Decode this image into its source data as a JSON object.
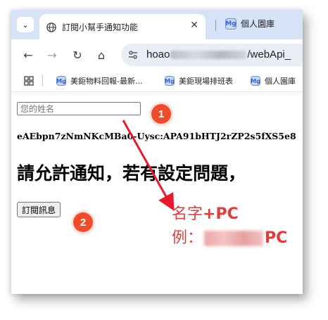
{
  "browser": {
    "tab_active_title": "訂閱小幫手通知功能",
    "tab_close": "✕",
    "tab_list": "⌄",
    "tab2_title": "個人園庫",
    "favicon_badge": "Mg",
    "url_prefix": "hoao",
    "url_suffix": "/webApi_",
    "nav": {
      "back": "←",
      "forward": "→",
      "reload": "↻",
      "home": "⌂"
    },
    "bookmarks": [
      {
        "label": "美鉅物料回報-最新..."
      },
      {
        "label": "美鉅現場排班表"
      },
      {
        "label": "個人園庫"
      }
    ]
  },
  "page": {
    "name_placeholder": "您的姓名",
    "token": "eAEbpn7zNmNKcMBa0-Uysc:APA91bHTJ2rZP2s5fXS5e8",
    "heading": "請允許通知，若有設定問題，",
    "subscribe_label": "訂閱訊息"
  },
  "annotations": {
    "badge1": "1",
    "badge2": "2",
    "line1_prefix": "名字",
    "line1_suffix": "+PC",
    "line2_prefix": "例：",
    "line2_suffix": "PC",
    "color": "#e03c3c"
  }
}
